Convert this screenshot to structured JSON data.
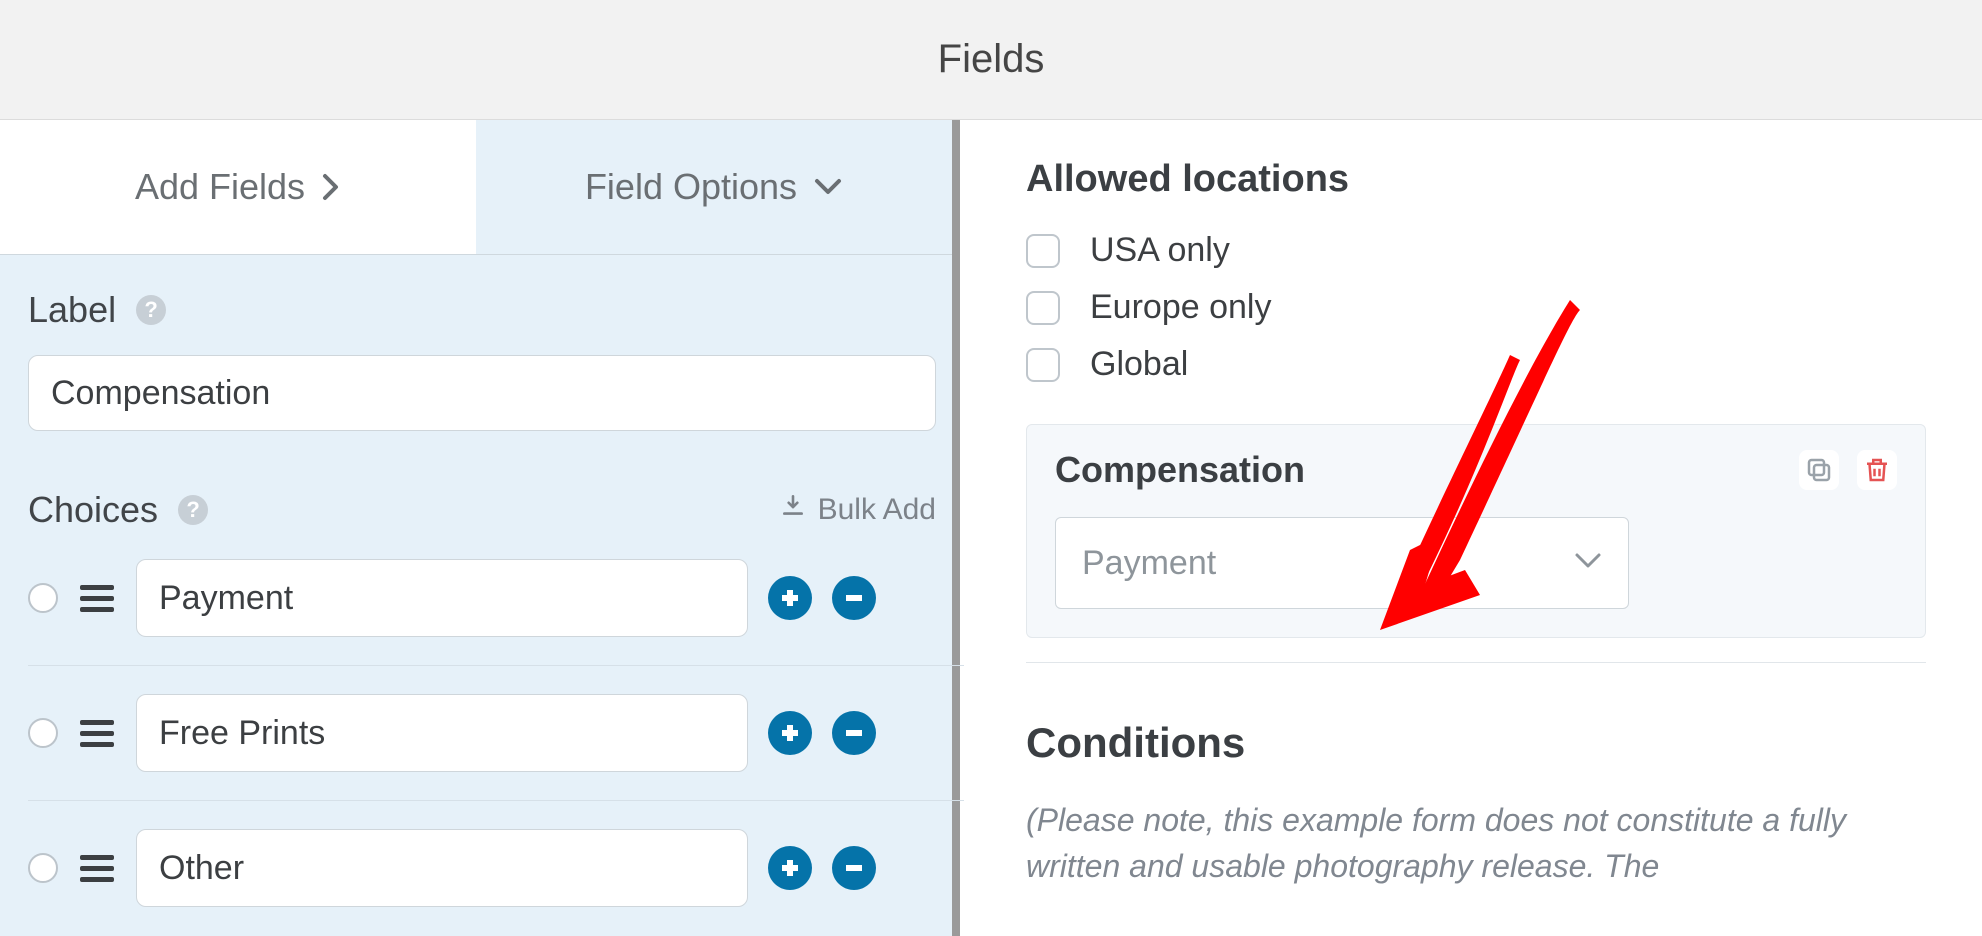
{
  "topbar": {
    "title": "Fields"
  },
  "tabs": {
    "add_fields": "Add Fields",
    "field_options": "Field Options"
  },
  "left_panel": {
    "label_label": "Label",
    "label_value": "Compensation",
    "choices_label": "Choices",
    "bulk_add": "Bulk Add",
    "choices": [
      {
        "value": "Payment"
      },
      {
        "value": "Free Prints"
      },
      {
        "value": "Other"
      }
    ]
  },
  "right_panel": {
    "allowed_heading": "Allowed locations",
    "location_options": [
      {
        "label": "USA only"
      },
      {
        "label": "Europe only"
      },
      {
        "label": "Global"
      }
    ],
    "selected_field": {
      "title": "Compensation",
      "selected_value": "Payment"
    },
    "conditions_heading": "Conditions",
    "conditions_note": "(Please note, this example form does not constitute a fully written and usable photography release. The"
  },
  "colors": {
    "accent": "#0573a9",
    "danger": "#e55353"
  }
}
